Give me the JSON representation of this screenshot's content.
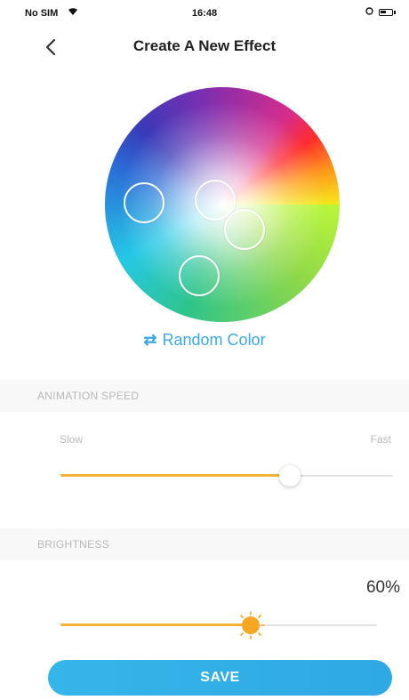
{
  "status_bar": {
    "carrier": "No SIM",
    "time": "16:48"
  },
  "header": {
    "title": "Create A New Effect"
  },
  "color_wheel": {
    "marker_count": 4
  },
  "random_color": {
    "icon": "shuffle-icon",
    "label": "Random Color"
  },
  "animation_speed": {
    "heading": "ANIMATION SPEED",
    "min_label": "Slow",
    "max_label": "Fast",
    "value_fraction": 0.69
  },
  "brightness": {
    "heading": "BRIGHTNESS",
    "value_text": "60%",
    "value_percent": 60
  },
  "colors": {
    "accent_orange": "#f2b33a",
    "accent_blue": "#3ea8e4"
  },
  "save_button": {
    "label": "SAVE"
  }
}
